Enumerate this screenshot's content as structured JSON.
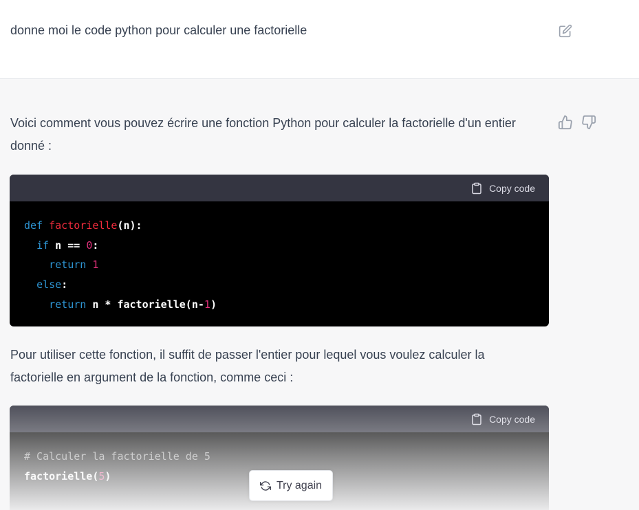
{
  "user_message": {
    "text": "donne moi le code python pour calculer une factorielle",
    "edit_icon": "edit-icon"
  },
  "assistant": {
    "paragraph_1": "Voici comment vous pouvez écrire une fonction Python pour calculer la factorielle d'un entier donné :",
    "paragraph_2": "Pour utiliser cette fonction, il suffit de passer l'entier pour lequel vous voulez calculer la factorielle en argument de la fonction, comme ceci :",
    "feedback_icons": [
      "thumbs-up-icon",
      "thumbs-down-icon"
    ]
  },
  "code_blocks": [
    {
      "copy_label": "Copy code",
      "lines": {
        "l1_kw": "def",
        "l1_fn": "factorielle",
        "l1_rest": "(n):",
        "l2_kw": "if",
        "l2_rest": "n ==",
        "l2_num": "0",
        "l2_end": ":",
        "l3_kw": "return",
        "l3_num": "1",
        "l4_kw": "else",
        "l4_end": ":",
        "l5_kw": "return",
        "l5_rest": "n * factorielle(n-",
        "l5_num": "1",
        "l5_end": ")"
      }
    },
    {
      "copy_label": "Copy code",
      "lines": {
        "l1_cmt": "# Calculer la factorielle de 5",
        "l2_fn": "factorielle(",
        "l2_num": "5",
        "l2_end": ")"
      }
    }
  ],
  "try_again_label": "Try again",
  "colors": {
    "page_bg": "#f7f7f8",
    "code_header": "#343541",
    "code_bg": "#000000",
    "keyword": "#2e95d3",
    "function": "#f22c3d",
    "number": "#df3079"
  }
}
